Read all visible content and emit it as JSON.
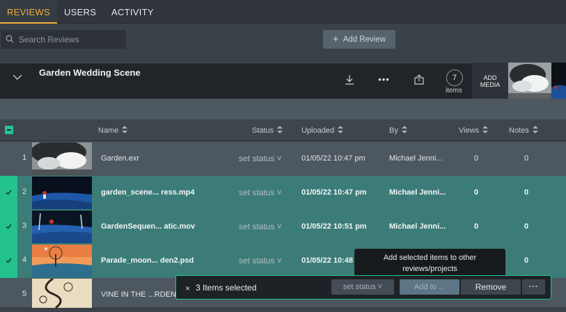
{
  "tabs": [
    {
      "label": "REVIEWS",
      "active": true
    },
    {
      "label": "USERS",
      "active": false
    },
    {
      "label": "ACTIVITY",
      "active": false
    }
  ],
  "search": {
    "placeholder": "Search Reviews",
    "value": ""
  },
  "add_review_label": "Add Review",
  "review": {
    "title": "Garden Wedding Scene",
    "item_count": "7",
    "item_count_label": "items",
    "add_media_line1": "ADD",
    "add_media_line2": "MEDIA"
  },
  "columns": {
    "name": "Name",
    "status": "Status",
    "uploaded": "Uploaded",
    "by": "By",
    "views": "Views",
    "notes": "Notes"
  },
  "rows": [
    {
      "index": "1",
      "name": "Garden.exr",
      "status": "set status",
      "uploaded": "01/05/22 10:47 pm",
      "by": "Michael Jenni...",
      "views": "0",
      "notes": "0",
      "selected": false
    },
    {
      "index": "2",
      "name": "garden_scene... ress.mp4",
      "status": "set status",
      "uploaded": "01/05/22 10:47 pm",
      "by": "Michael Jenni...",
      "views": "0",
      "notes": "0",
      "selected": true
    },
    {
      "index": "3",
      "name": "GardenSequen... atic.mov",
      "status": "set status",
      "uploaded": "01/05/22 10:51 pm",
      "by": "Michael Jenni...",
      "views": "0",
      "notes": "0",
      "selected": true
    },
    {
      "index": "4",
      "name": "Parade_moon... den2.psd",
      "status": "set status",
      "uploaded": "01/05/22 10:48",
      "by": "",
      "views": "",
      "notes": "0",
      "selected": true
    },
    {
      "index": "5",
      "name": "VINE IN THE ...RDEN.",
      "status": "",
      "uploaded": "",
      "by": "",
      "views": "",
      "notes": "",
      "selected": false
    }
  ],
  "tooltip": {
    "line1": "Add selected items to other",
    "line2": "reviews/projects"
  },
  "action_bar": {
    "close_glyph": "×",
    "selected_text": "3 Items selected",
    "set_status_label": "set status",
    "add_to_label": "Add to ...",
    "remove_label": "Remove",
    "more_label": "···"
  },
  "colors": {
    "accent_tab": "#f2b13a",
    "accent_green": "#22c593"
  }
}
